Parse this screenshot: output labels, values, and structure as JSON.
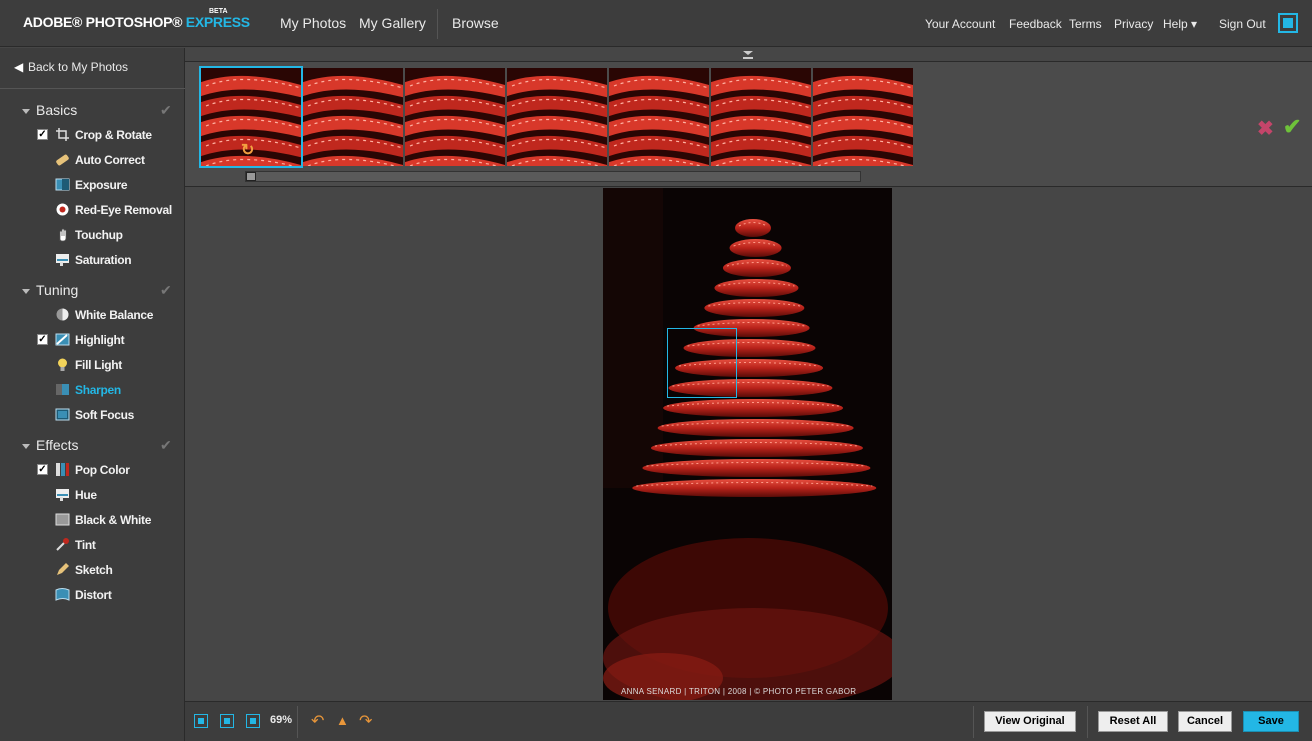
{
  "header": {
    "logo_main": "ADOBE® PHOTOSHOP®",
    "logo_accent": "EXPRESS",
    "beta": "BETA",
    "nav": [
      "My Photos",
      "My Gallery",
      "Browse"
    ],
    "right_nav": [
      "Your Account",
      "Feedback",
      "Terms",
      "Privacy",
      "Help ▾",
      "Sign Out"
    ]
  },
  "sidebar": {
    "back_label": "Back to My Photos",
    "sections": [
      {
        "title": "Basics",
        "tools": [
          "Crop & Rotate",
          "Auto Correct",
          "Exposure",
          "Red-Eye Removal",
          "Touchup",
          "Saturation"
        ]
      },
      {
        "title": "Tuning",
        "tools": [
          "White Balance",
          "Highlight",
          "Fill Light",
          "Sharpen",
          "Soft Focus"
        ]
      },
      {
        "title": "Effects",
        "tools": [
          "Pop Color",
          "Hue",
          "Black & White",
          "Tint",
          "Sketch",
          "Distort"
        ]
      }
    ],
    "active_tool": "Sharpen",
    "checked_tools": [
      "Crop & Rotate",
      "Highlight",
      "Pop Color"
    ]
  },
  "filmstrip": {
    "thumbnail_count": 7,
    "selected_index": 0
  },
  "photo": {
    "credit": "ANNA SENARD | TRITON | 2008 | © PHOTO PETER GABOR"
  },
  "bottombar": {
    "zoom": "69%",
    "view_original": "View Original",
    "reset_all": "Reset All",
    "cancel": "Cancel",
    "save": "Save"
  },
  "colors": {
    "accent": "#23b7e5",
    "photo_red": "#c0281e",
    "cancel_x": "#c4456a",
    "confirm_check": "#6ec23a"
  }
}
